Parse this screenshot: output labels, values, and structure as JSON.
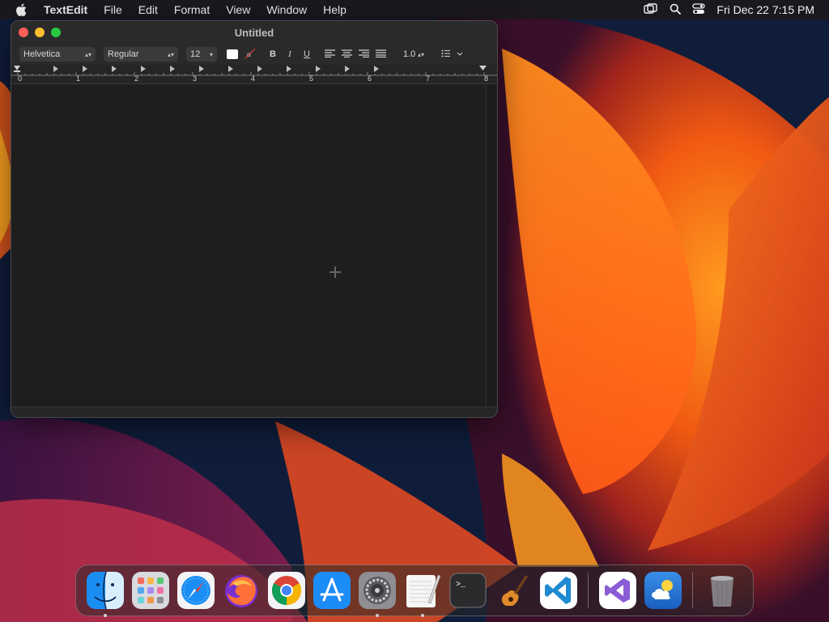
{
  "menubar": {
    "app_name": "TextEdit",
    "menus": [
      "File",
      "Edit",
      "Format",
      "View",
      "Window",
      "Help"
    ],
    "clock": "Fri Dec 22  7:15 PM",
    "icons": [
      "apple-icon",
      "screen-mirroring-icon",
      "spotlight-search-icon",
      "control-center-icon"
    ]
  },
  "window": {
    "title": "Untitled",
    "toolbar": {
      "font_family": "Helvetica",
      "font_style": "Regular",
      "font_size": "12",
      "bold_label": "B",
      "italic_label": "I",
      "underline_label": "U",
      "line_spacing": "1.0"
    },
    "ruler": {
      "labels": [
        "0",
        "1",
        "2",
        "3",
        "4",
        "5",
        "6",
        "7",
        "8"
      ]
    }
  },
  "dock": {
    "apps": [
      "Finder",
      "Launchpad",
      "Safari",
      "Firefox",
      "Google Chrome",
      "App Store",
      "System Settings",
      "TextEdit",
      "Terminal",
      "GarageBand",
      "Visual Studio Code",
      "Visual Studio",
      "Weather",
      "Trash"
    ],
    "running": [
      "Finder",
      "System Settings",
      "TextEdit"
    ]
  },
  "colors": {
    "close": "#fe5f57",
    "minimize": "#febc2e",
    "zoom": "#28c840",
    "window_bg": "#1e1e1e"
  }
}
